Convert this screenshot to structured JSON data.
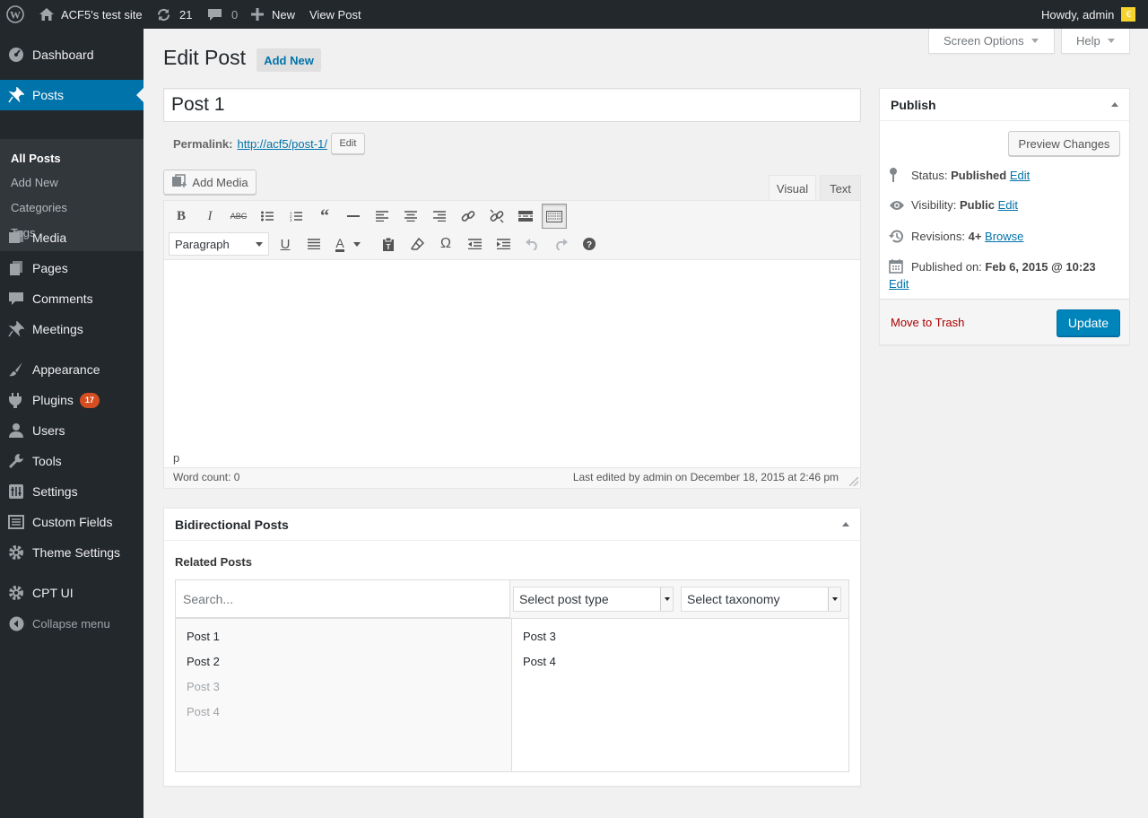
{
  "adminbar": {
    "site_name": "ACF5's test site",
    "updates_count": "21",
    "comments_count": "0",
    "new_label": "New",
    "view_post_label": "View Post",
    "howdy": "Howdy, admin"
  },
  "sidebar": {
    "items": [
      {
        "label": "Dashboard",
        "icon": "dashboard-icon"
      },
      {
        "label": "Posts",
        "icon": "pushpin-icon"
      },
      {
        "label": "Media",
        "icon": "media-icon"
      },
      {
        "label": "Pages",
        "icon": "pages-icon"
      },
      {
        "label": "Comments",
        "icon": "comment-icon"
      },
      {
        "label": "Meetings",
        "icon": "pushpin-icon"
      },
      {
        "label": "Appearance",
        "icon": "brush-icon"
      },
      {
        "label": "Plugins",
        "icon": "plugin-icon",
        "badge": "17"
      },
      {
        "label": "Users",
        "icon": "user-icon"
      },
      {
        "label": "Tools",
        "icon": "wrench-icon"
      },
      {
        "label": "Settings",
        "icon": "settings-icon"
      },
      {
        "label": "Custom Fields",
        "icon": "list-icon"
      },
      {
        "label": "Theme Settings",
        "icon": "gear-icon"
      },
      {
        "label": "CPT UI",
        "icon": "gear-icon"
      },
      {
        "label": "Collapse menu",
        "icon": "collapse-icon"
      }
    ],
    "submenu": [
      "All Posts",
      "Add New",
      "Categories",
      "Tags"
    ]
  },
  "header": {
    "screen_options": "Screen Options",
    "help": "Help",
    "title": "Edit Post",
    "add_new": "Add New"
  },
  "post": {
    "title": "Post 1",
    "permalink_label": "Permalink:",
    "permalink_url": "http://acf5/post-1/",
    "permalink_edit": "Edit"
  },
  "editor": {
    "add_media": "Add Media",
    "tab_visual": "Visual",
    "tab_text": "Text",
    "format_select": "Paragraph",
    "path": "p",
    "word_count": "Word count: 0",
    "last_edited": "Last edited by admin on December 18, 2015 at 2:46 pm"
  },
  "bidirectional": {
    "title": "Bidirectional Posts",
    "field_label": "Related Posts",
    "search_placeholder": "Search...",
    "post_type_select": "Select post type",
    "taxonomy_select": "Select taxonomy",
    "choices": [
      {
        "label": "Post 1",
        "disabled": false
      },
      {
        "label": "Post 2",
        "disabled": false
      },
      {
        "label": "Post 3",
        "disabled": true
      },
      {
        "label": "Post 4",
        "disabled": true
      }
    ],
    "selected": [
      "Post 3",
      "Post 4"
    ]
  },
  "publish": {
    "title": "Publish",
    "preview": "Preview Changes",
    "status_label": "Status:",
    "status_value": "Published",
    "visibility_label": "Visibility:",
    "visibility_value": "Public",
    "revisions_label": "Revisions:",
    "revisions_value": "4+",
    "browse": "Browse",
    "published_label": "Published on:",
    "published_value": "Feb 6, 2015 @ 10:23",
    "edit": "Edit",
    "trash": "Move to Trash",
    "update": "Update"
  },
  "colors": {
    "admin_dark": "#23282d",
    "accent": "#0073aa",
    "trash": "#a00",
    "update_button": "#0085ba"
  }
}
